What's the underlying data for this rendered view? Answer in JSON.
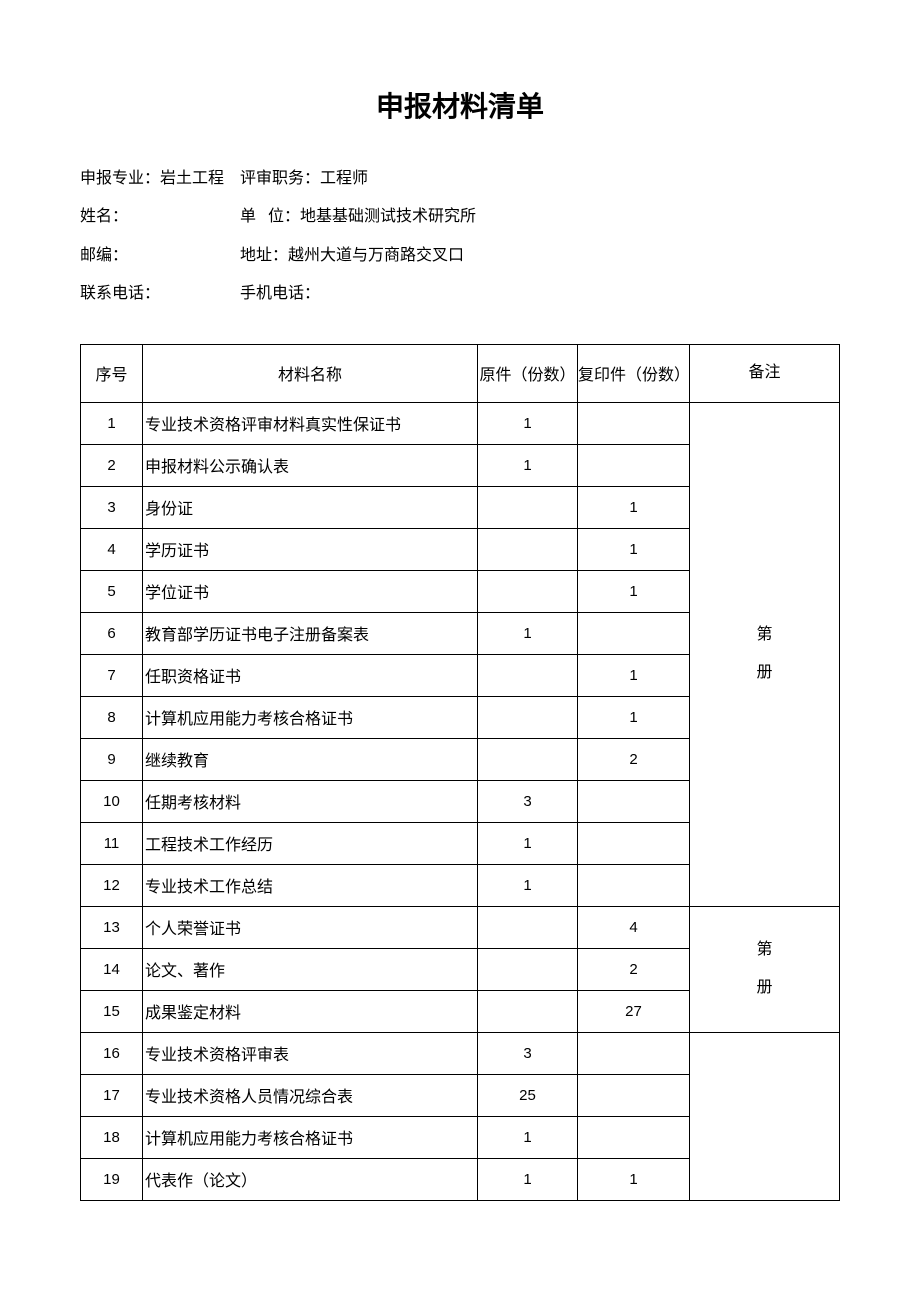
{
  "title": "申报材料清单",
  "info": {
    "row1_left": "申报专业：岩土工程",
    "row1_right": "评审职务：工程师",
    "row2_left": "姓名：",
    "row2_right": "单   位：地基基础测试技术研究所",
    "row3_left": "邮编：",
    "row3_right": "地址：越州大道与万商路交叉口",
    "row4_left": "联系电话：",
    "row4_right": "手机电话："
  },
  "headers": {
    "seq": "序号",
    "name": "材料名称",
    "orig": "原件（份数）",
    "copy": "复印件（份数）",
    "remark": "备注"
  },
  "remarks": {
    "group1": "第\n册",
    "group2": "第\n册"
  },
  "rows": [
    {
      "seq": "1",
      "name": "专业技术资格评审材料真实性保证书",
      "orig": "1",
      "copy": ""
    },
    {
      "seq": "2",
      "name": "申报材料公示确认表",
      "orig": "1",
      "copy": ""
    },
    {
      "seq": "3",
      "name": "身份证",
      "orig": "",
      "copy": "1"
    },
    {
      "seq": "4",
      "name": "学历证书",
      "orig": "",
      "copy": "1"
    },
    {
      "seq": "5",
      "name": "学位证书",
      "orig": "",
      "copy": "1"
    },
    {
      "seq": "6",
      "name": "教育部学历证书电子注册备案表",
      "orig": "1",
      "copy": ""
    },
    {
      "seq": "7",
      "name": "任职资格证书",
      "orig": "",
      "copy": "1"
    },
    {
      "seq": "8",
      "name": "计算机应用能力考核合格证书",
      "orig": "",
      "copy": "1"
    },
    {
      "seq": "9",
      "name": "继续教育",
      "orig": "",
      "copy": "2"
    },
    {
      "seq": "10",
      "name": "任期考核材料",
      "orig": "3",
      "copy": ""
    },
    {
      "seq": "11",
      "name": "工程技术工作经历",
      "orig": "1",
      "copy": ""
    },
    {
      "seq": "12",
      "name": "专业技术工作总结",
      "orig": "1",
      "copy": ""
    },
    {
      "seq": "13",
      "name": "个人荣誉证书",
      "orig": "",
      "copy": "4"
    },
    {
      "seq": "14",
      "name": "论文、著作",
      "orig": "",
      "copy": "2"
    },
    {
      "seq": "15",
      "name": "成果鉴定材料",
      "orig": "",
      "copy": "27"
    },
    {
      "seq": "16",
      "name": "专业技术资格评审表",
      "orig": "3",
      "copy": ""
    },
    {
      "seq": "17",
      "name": "专业技术资格人员情况综合表",
      "orig": "25",
      "copy": ""
    },
    {
      "seq": "18",
      "name": "计算机应用能力考核合格证书",
      "orig": "1",
      "copy": ""
    },
    {
      "seq": "19",
      "name": "代表作（论文）",
      "orig": "1",
      "copy": "1"
    }
  ]
}
